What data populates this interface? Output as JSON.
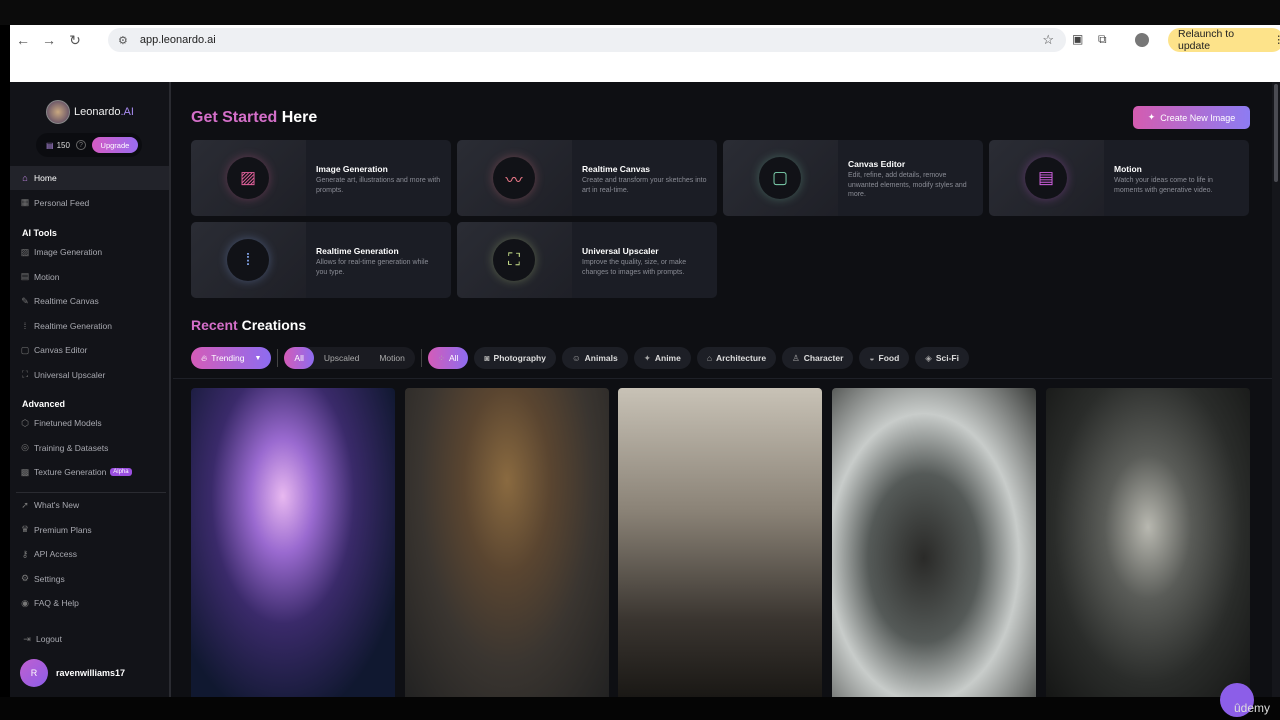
{
  "browser": {
    "url": "app.leonardo.ai",
    "relaunch_label": "Relaunch to update"
  },
  "sidebar": {
    "brand": "Leonardo",
    "brand_suffix": ".AI",
    "credits": "150",
    "upgrade": "Upgrade",
    "top_items": [
      {
        "label": "Home",
        "icon": "home-icon",
        "active": true
      },
      {
        "label": "Personal Feed",
        "icon": "grid-icon"
      }
    ],
    "ai_tools_heading": "AI Tools",
    "ai_tools": [
      {
        "label": "Image Generation",
        "icon": "image-icon"
      },
      {
        "label": "Motion",
        "icon": "film-icon"
      },
      {
        "label": "Realtime Canvas",
        "icon": "brush-icon"
      },
      {
        "label": "Realtime Generation",
        "icon": "dots-grid-icon"
      },
      {
        "label": "Canvas Editor",
        "icon": "frame-icon"
      },
      {
        "label": "Universal Upscaler",
        "icon": "upscale-icon"
      }
    ],
    "advanced_heading": "Advanced",
    "advanced": [
      {
        "label": "Finetuned Models",
        "icon": "cube-icon"
      },
      {
        "label": "Training & Datasets",
        "icon": "database-icon"
      },
      {
        "label": "Texture Generation",
        "icon": "texture-icon",
        "badge": "Alpha"
      }
    ],
    "other": [
      {
        "label": "What's New",
        "icon": "rocket-icon"
      },
      {
        "label": "Premium Plans",
        "icon": "crown-icon"
      },
      {
        "label": "API Access",
        "icon": "key-icon"
      },
      {
        "label": "Settings",
        "icon": "gear-icon"
      },
      {
        "label": "FAQ & Help",
        "icon": "help-icon"
      }
    ],
    "logout": "Logout",
    "user": {
      "initial": "R",
      "name": "ravenwilliams17"
    }
  },
  "main": {
    "get_started": {
      "accent": "Get Started",
      "rest": " Here"
    },
    "create_button": "Create New Image",
    "cards": [
      {
        "title": "Image Generation",
        "desc": "Generate art, illustrations and more with prompts.",
        "icon": "image-stack-icon",
        "color": "#e0609a"
      },
      {
        "title": "Realtime Canvas",
        "desc": "Create and transform your sketches into art in real-time.",
        "icon": "scribble-icon",
        "color": "#f07a8a"
      },
      {
        "title": "Canvas Editor",
        "desc": "Edit, refine, add details, remove unwanted elements, modify styles and more.",
        "icon": "frame-icon",
        "color": "#7fd4b0"
      },
      {
        "title": "Motion",
        "desc": "Watch your ideas come to life in moments with generative video.",
        "icon": "film-icon",
        "color": "#d060e0"
      },
      {
        "title": "Realtime Generation",
        "desc": "Allows for real-time generation while you type.",
        "icon": "dots-grid-icon",
        "color": "#8fb4ff"
      },
      {
        "title": "Universal Upscaler",
        "desc": "Improve the quality, size, or make changes to images with prompts.",
        "icon": "upscale-icon",
        "color": "#c8e08a"
      }
    ],
    "recent": {
      "accent": "Recent",
      "rest": " Creations"
    },
    "filters": {
      "sort": "Trending",
      "types": [
        "All",
        "Upscaled",
        "Motion"
      ],
      "categories": [
        "All",
        "Photography",
        "Animals",
        "Anime",
        "Architecture",
        "Character",
        "Food",
        "Sci-Fi"
      ]
    }
  },
  "footer": {
    "brand": "ûdemy"
  }
}
